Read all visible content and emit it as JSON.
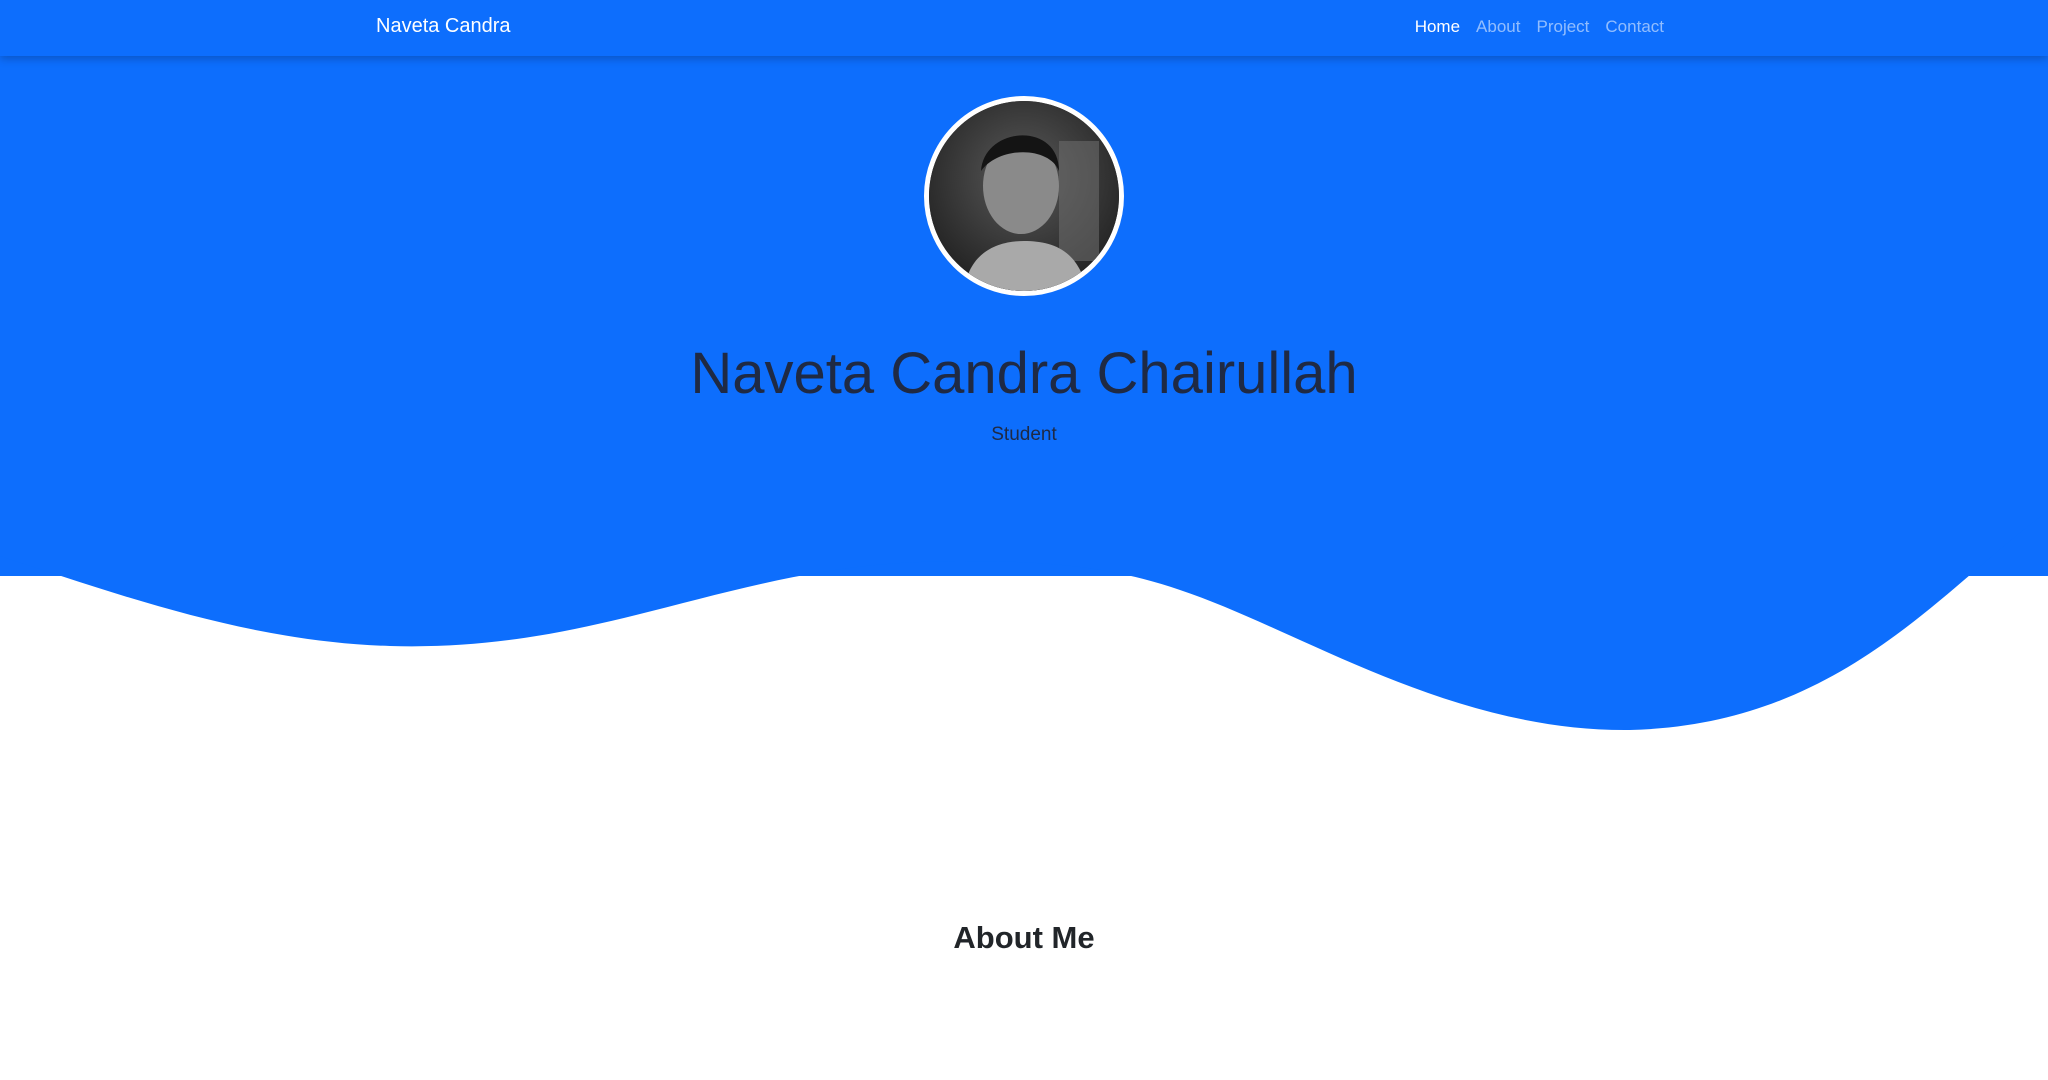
{
  "navbar": {
    "brand": "Naveta Candra",
    "links": [
      {
        "label": "Home",
        "active": true
      },
      {
        "label": "About",
        "active": false
      },
      {
        "label": "Project",
        "active": false
      },
      {
        "label": "Contact",
        "active": false
      }
    ]
  },
  "hero": {
    "name": "Naveta Candra Chairullah",
    "subtitle": "Student"
  },
  "about": {
    "title": "About Me"
  },
  "colors": {
    "primary": "#0d6efd",
    "background": "#ffffff",
    "text_dark": "#212529"
  }
}
